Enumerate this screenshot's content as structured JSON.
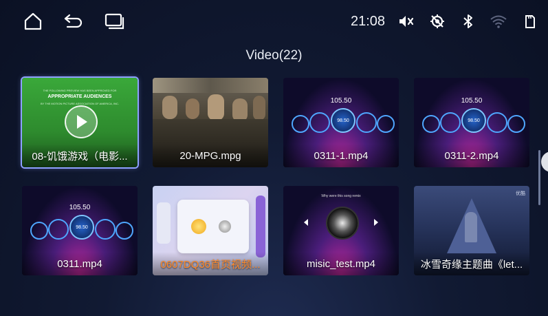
{
  "status_bar": {
    "time": "21:08",
    "left_icons": [
      "home-icon",
      "back-icon",
      "recent-apps-icon"
    ],
    "right_icons": [
      "mute-icon",
      "no-gps-icon",
      "bluetooth-icon",
      "wifi-icon",
      "sd-card-icon"
    ]
  },
  "page": {
    "title": "Video(22)"
  },
  "videos": [
    {
      "title": "08-饥饿游戏（电影..."
    },
    {
      "title": "20-MPG.mpg"
    },
    {
      "title": "0311-1.mp4"
    },
    {
      "title": "0311-2.mp4"
    },
    {
      "title": "0311.mp4"
    },
    {
      "title": "0607DQ36首页视频..."
    },
    {
      "title": "misic_test.mp4"
    },
    {
      "title": "冰雪奇缘主题曲《let..."
    }
  ],
  "thumb_text": {
    "green_line1": "THE FOLLOWING PREVIEW HAS BEEN APPROVED FOR",
    "green_line2": "APPROPRIATE AUDIENCES",
    "green_line3": "BY THE MOTION PICTURE ASSOCIATION OF AMERICA, INC.",
    "radio_freq": "105.50",
    "radio_knob": "98.50",
    "music_header": "Why were this song remix",
    "corner_tag": "优酷"
  }
}
